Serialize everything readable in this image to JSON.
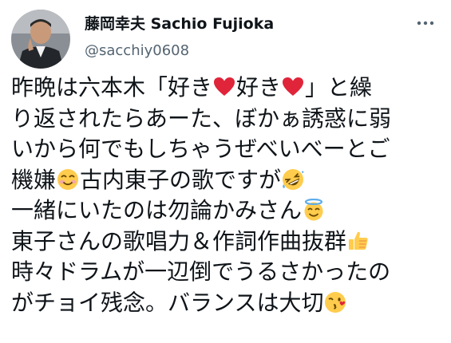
{
  "author": {
    "display_name": "藤岡幸夫 Sachio Fujioka",
    "handle": "@sacchiy0608"
  },
  "tweet": {
    "lines": [
      {
        "before": "昨晩は六本木「好き",
        "emoji1": "red-heart-icon",
        "middle": "好き",
        "emoji2": "red-heart-icon",
        "after": "」と繰"
      },
      {
        "text": "り返されたらあーた、ぼかぁ誘惑に弱"
      },
      {
        "text": "いから何でもしちゃうぜべいべーとご"
      },
      {
        "before": "機嫌",
        "emoji": "smiling-face-icon",
        "after": "古内東子の歌ですが",
        "emoji_end": "rolling-on-floor-laughing-icon"
      },
      {
        "before": "一緒にいたのは勿論かみさん",
        "emoji_end": "smiling-face-with-halo-icon"
      },
      {
        "before": "東子さんの歌唱力＆作詞作曲抜群",
        "emoji_end": "thumbs-up-icon"
      },
      {
        "text": "時々ドラムが一辺倒でうるさかったの"
      },
      {
        "before": "がチョイ残念。バランスは大切",
        "emoji_end": "face-blowing-kiss-icon"
      }
    ]
  },
  "icons": {
    "more": "more-options-icon"
  },
  "colors": {
    "text": "#0f1419",
    "secondary": "#536471",
    "heart": "#e0243a",
    "emoji_yellow": "#ffcc4d"
  }
}
